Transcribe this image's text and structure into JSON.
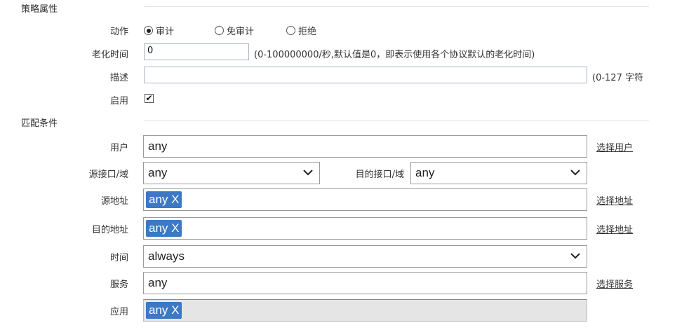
{
  "sections": {
    "policy": "策略属性",
    "match": "匹配条件"
  },
  "policy": {
    "action_label": "动作",
    "action_options": [
      "审计",
      "免审计",
      "拒绝"
    ],
    "action_selected": "审计",
    "aging_label": "老化时间",
    "aging_value": "0",
    "aging_hint": "(0-100000000/秒,默认值是0，即表示使用各个协议默认的老化时间)",
    "desc_label": "描述",
    "desc_value": "",
    "desc_hint": "(0-127 字符",
    "enable_label": "启用",
    "enable_checked": true,
    "enable_glyph": "✔"
  },
  "match": {
    "user_label": "用户",
    "user_value": "any",
    "user_link": "选择用户",
    "src_if_label": "源接口/域",
    "src_if_value": "any",
    "dst_if_label": "目的接口/域",
    "dst_if_value": "any",
    "src_addr_label": "源地址",
    "src_addr_tag": "any X",
    "src_addr_link": "选择地址",
    "dst_addr_label": "目的地址",
    "dst_addr_tag": "any X",
    "dst_addr_link": "选择地址",
    "time_label": "时间",
    "time_value": "always",
    "service_label": "服务",
    "service_value": "any",
    "service_link": "选择服务",
    "app_label": "应用",
    "app_tag": "any X"
  }
}
